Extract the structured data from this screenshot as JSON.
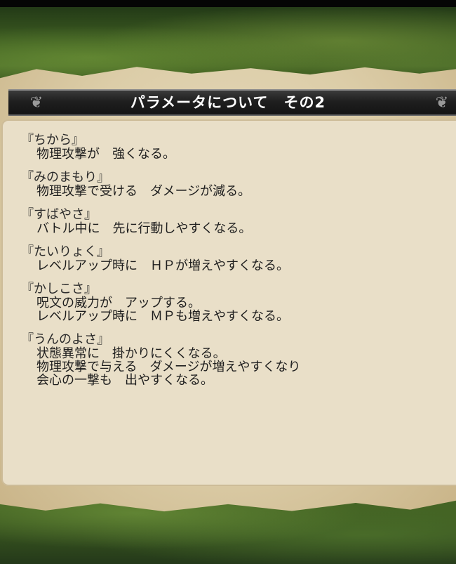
{
  "title": "パラメータについて　その2",
  "params": [
    {
      "name": "『ちから』",
      "desc": [
        "物理攻撃が　強くなる。"
      ]
    },
    {
      "name": "『みのまもり』",
      "desc": [
        "物理攻撃で受ける　ダメージが減る。"
      ]
    },
    {
      "name": "『すばやさ』",
      "desc": [
        "バトル中に　先に行動しやすくなる。"
      ]
    },
    {
      "name": "『たいりょく』",
      "desc": [
        "レベルアップ時に　ＨＰが増えやすくなる。"
      ]
    },
    {
      "name": "『かしこさ』",
      "desc": [
        "呪文の威力が　アップする。",
        "レベルアップ時に　ＭＰも増えやすくなる。"
      ]
    },
    {
      "name": "『うんのよさ』",
      "desc": [
        "状態異常に　掛かりにくくなる。",
        "物理攻撃で与える　ダメージが増えやすくなり",
        "会心の一撃も　出やすくなる。"
      ]
    }
  ],
  "colors": {
    "title_bg": "#1f1f1f",
    "parchment": "#e9dfc8",
    "text": "#1e1e1e"
  }
}
